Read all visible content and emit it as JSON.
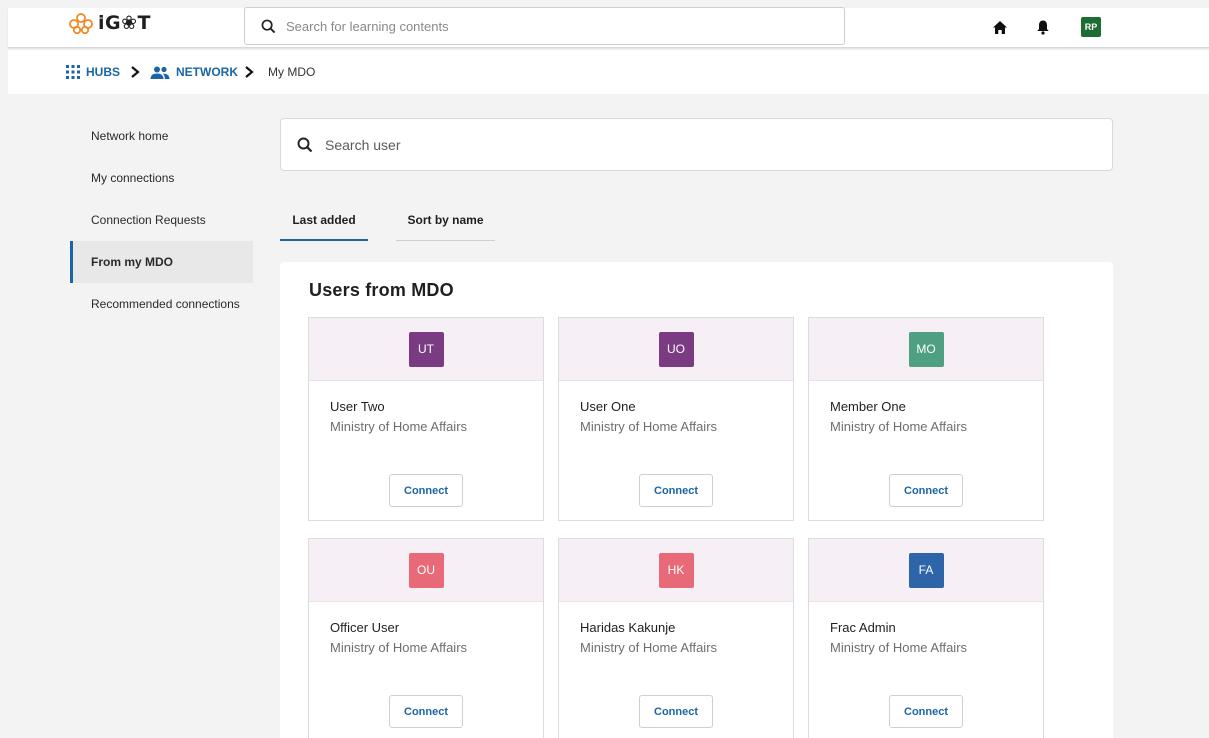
{
  "header": {
    "logo_text": "iG❀T",
    "search_placeholder": "Search for learning contents",
    "avatar_initials": "RP",
    "icons": [
      "logo-icon",
      "search-icon",
      "home-icon",
      "bell-icon"
    ]
  },
  "breadcrumb": {
    "items": [
      {
        "label": "HUBS",
        "icon": "grid-icon"
      },
      {
        "label": "NETWORK",
        "icon": "people-icon"
      }
    ],
    "current": "My MDO"
  },
  "sidebar": {
    "items": [
      {
        "label": "Network home",
        "active": false
      },
      {
        "label": "My connections",
        "active": false
      },
      {
        "label": "Connection Requests",
        "active": false
      },
      {
        "label": "From my MDO",
        "active": true
      },
      {
        "label": "Recommended connections",
        "active": false
      }
    ]
  },
  "user_search": {
    "placeholder": "Search user"
  },
  "tabs": [
    {
      "label": "Last added",
      "active": true
    },
    {
      "label": "Sort by name",
      "active": false
    }
  ],
  "panel": {
    "title": "Users from MDO",
    "users": [
      {
        "initials": "UT",
        "name": "User Two",
        "org": "Ministry of Home Affairs",
        "color": "#7b3b82",
        "action": "Connect"
      },
      {
        "initials": "UO",
        "name": "User One",
        "org": "Ministry of Home Affairs",
        "color": "#7b3b82",
        "action": "Connect"
      },
      {
        "initials": "MO",
        "name": "Member One",
        "org": "Ministry of Home Affairs",
        "color": "#4fa083",
        "action": "Connect"
      },
      {
        "initials": "OU",
        "name": "Officer User",
        "org": "Ministry of Home Affairs",
        "color": "#e86a78",
        "action": "Connect"
      },
      {
        "initials": "HK",
        "name": "Haridas Kakunje",
        "org": "Ministry of Home Affairs",
        "color": "#e86a78",
        "action": "Connect"
      },
      {
        "initials": "FA",
        "name": "Frac Admin",
        "org": "Ministry of Home Affairs",
        "color": "#2e64a8",
        "action": "Connect"
      }
    ]
  },
  "colors": {
    "accent": "#1b65a6",
    "avatar_bg": "#1e6b34",
    "card_header_bg": "#f6f0f6"
  }
}
